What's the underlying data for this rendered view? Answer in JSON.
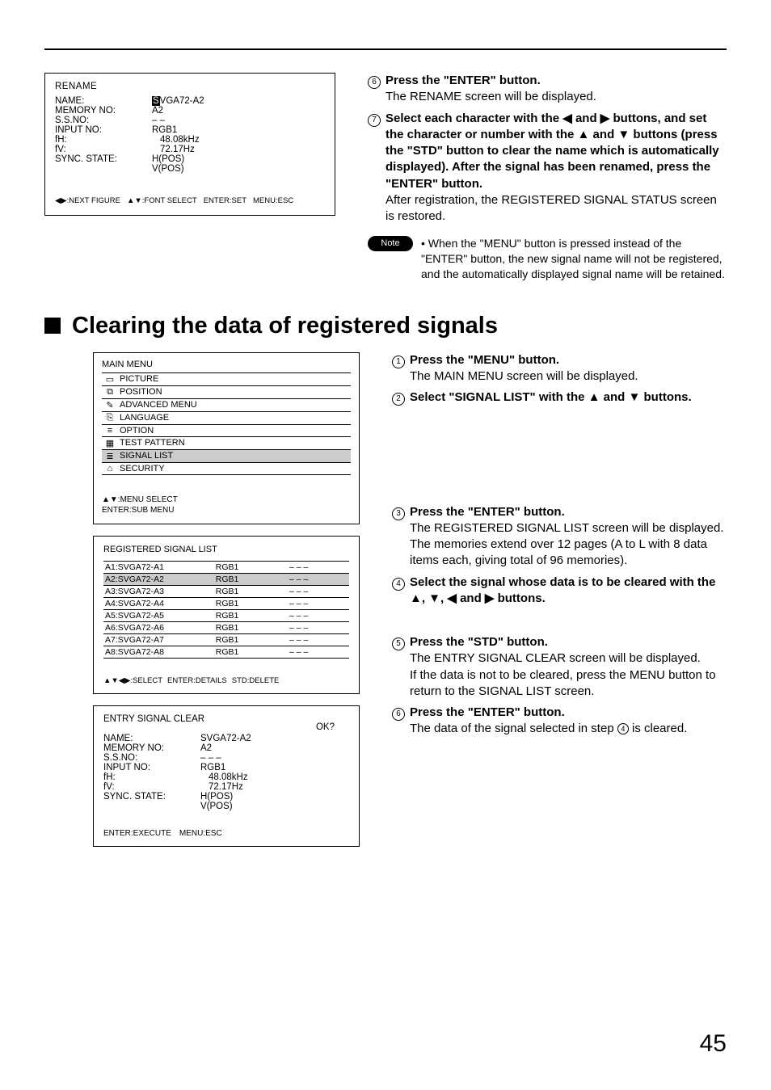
{
  "rename_box": {
    "title": "RENAME",
    "name_label": "NAME:",
    "name_cursor": "S",
    "name_rest": "VGA72-A2",
    "mem_label": "MEMORY NO:",
    "mem_val": "A2",
    "ssno_label": "S.S.NO:",
    "ssno_val": "– –",
    "input_label": "INPUT NO:",
    "input_val": "RGB1",
    "fh_label": "fH:",
    "fh_val": "48.08kHz",
    "fv_label": "fV:",
    "fv_val": "72.17Hz",
    "sync_label": "SYNC. STATE:",
    "sync_v1": "H(POS)",
    "sync_v2": "V(POS)",
    "footer1": "◀▶:NEXT FIGURE",
    "footer2": "▲▼:FONT SELECT",
    "footer3": "ENTER:SET",
    "footer4": "MENU:ESC"
  },
  "top_steps": {
    "s6_head": "Press the \"ENTER\" button.",
    "s6_sub": "The RENAME screen will be displayed.",
    "s7_head": "Select each character with the ◀ and ▶ buttons, and set the character or number with the ▲ and ▼ buttons (press the \"STD\" button to clear the name which is automatically displayed).  After the signal has been renamed, press the \"ENTER\" button.",
    "s7_sub": "After registration, the REGISTERED SIGNAL STATUS screen is restored.",
    "note_label": "Note",
    "note_body": "• When the \"MENU\" button is pressed instead of the \"ENTER\" button, the new signal name will not be registered, and the automatically displayed signal name will be retained."
  },
  "section_title": "Clearing the data of registered signals",
  "main_menu": {
    "title": "MAIN MENU",
    "items": [
      {
        "label": "PICTURE",
        "sel": false
      },
      {
        "label": "POSITION",
        "sel": false
      },
      {
        "label": "ADVANCED MENU",
        "sel": false
      },
      {
        "label": "LANGUAGE",
        "sel": false
      },
      {
        "label": "OPTION",
        "sel": false
      },
      {
        "label": "TEST PATTERN",
        "sel": false
      },
      {
        "label": "SIGNAL LIST",
        "sel": true
      },
      {
        "label": "SECURITY",
        "sel": false
      }
    ],
    "footer1": "▲▼:MENU SELECT",
    "footer2": "ENTER:SUB MENU"
  },
  "sig_list": {
    "title": "REGISTERED SIGNAL LIST",
    "rows": [
      {
        "c1": "A1:SVGA72-A1",
        "c2": "RGB1",
        "c3": "– – –",
        "sel": false
      },
      {
        "c1": "A2:SVGA72-A2",
        "c2": "RGB1",
        "c3": "– – –",
        "sel": true
      },
      {
        "c1": "A3:SVGA72-A3",
        "c2": "RGB1",
        "c3": "– – –",
        "sel": false
      },
      {
        "c1": "A4:SVGA72-A4",
        "c2": "RGB1",
        "c3": "– – –",
        "sel": false
      },
      {
        "c1": "A5:SVGA72-A5",
        "c2": "RGB1",
        "c3": "– – –",
        "sel": false
      },
      {
        "c1": "A6:SVGA72-A6",
        "c2": "RGB1",
        "c3": "– – –",
        "sel": false
      },
      {
        "c1": "A7:SVGA72-A7",
        "c2": "RGB1",
        "c3": "– – –",
        "sel": false
      },
      {
        "c1": "A8:SVGA72-A8",
        "c2": "RGB1",
        "c3": "– – –",
        "sel": false
      }
    ],
    "footer1": "▲▼◀▶:SELECT",
    "footer2": "ENTER:DETAILS",
    "footer3": "STD:DELETE"
  },
  "clear_box": {
    "title": "ENTRY SIGNAL CLEAR",
    "ok": "OK?",
    "name_label": "NAME:",
    "name_val": "SVGA72-A2",
    "mem_label": "MEMORY NO:",
    "mem_val": "A2",
    "ssno_label": "S.S.NO:",
    "ssno_val": "– – –",
    "input_label": "INPUT NO:",
    "input_val": "RGB1",
    "fh_label": "fH:",
    "fh_val": "48.08kHz",
    "fv_label": "fV:",
    "fv_val": "72.17Hz",
    "sync_label": "SYNC. STATE:",
    "sync_v1": "H(POS)",
    "sync_v2": "V(POS)",
    "footer1": "ENTER:EXECUTE",
    "footer2": "MENU:ESC"
  },
  "bottom_steps": {
    "r1_head": "Press the \"MENU\" button.",
    "r1_sub": "The MAIN MENU screen will be displayed.",
    "r2_head": "Select \"SIGNAL LIST\" with the ▲ and ▼ buttons.",
    "r3_head": "Press the \"ENTER\" button.",
    "r3_sub": "The REGISTERED SIGNAL LIST screen will be displayed.  The memories extend over 12 pages (A to L with 8 data items each, giving total of 96 memories).",
    "r4_head": "Select the signal whose data is to be cleared with the ▲, ▼, ◀ and ▶ buttons.",
    "r5_head": "Press the \"STD\" button.",
    "r5_sub": "The ENTRY SIGNAL CLEAR screen will be displayed.\nIf the data is not to be cleared, press the MENU button to return to the SIGNAL LIST screen.",
    "r6_head": "Press the \"ENTER\" button.",
    "r6_sub_a": "The data of the signal selected in step ",
    "r6_sub_b": " is cleared."
  },
  "page_number": "45"
}
